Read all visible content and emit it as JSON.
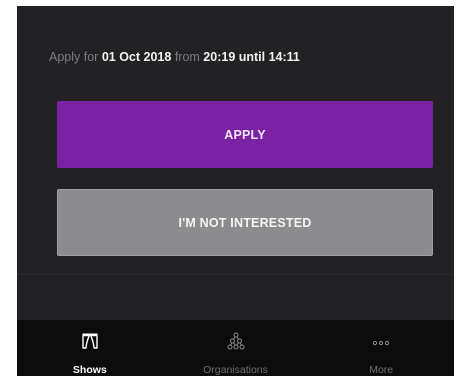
{
  "apply_line": {
    "prefix": "Apply for",
    "date": "01 Oct 2018",
    "from_word": "from",
    "time_range": "20:19 until 14:11"
  },
  "buttons": {
    "apply_label": "APPLY",
    "not_interested_label": "I'M NOT INTERESTED"
  },
  "tabbar": {
    "tabs": [
      {
        "label": "Shows",
        "icon": "theater-curtains-icon",
        "active": true
      },
      {
        "label": "Organisations",
        "icon": "org-hierarchy-icon",
        "active": false
      },
      {
        "label": "More",
        "icon": "more-dots-icon",
        "active": false
      }
    ]
  },
  "colors": {
    "background": "#222224",
    "apply_button": "#7b22a4",
    "not_interested_button": "#8c8c8e",
    "tabbar": "#0c0c0c"
  }
}
